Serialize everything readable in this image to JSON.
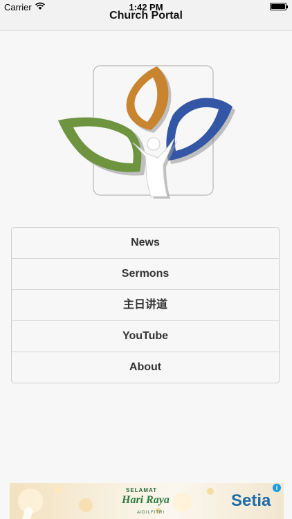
{
  "status_bar": {
    "carrier": "Carrier",
    "time": "1:42 PM"
  },
  "nav": {
    "title": "Church Portal"
  },
  "menu": {
    "items": [
      {
        "label": "News"
      },
      {
        "label": "Sermons"
      },
      {
        "label": "主日讲道"
      },
      {
        "label": "YouTube"
      },
      {
        "label": "About"
      }
    ]
  },
  "ad": {
    "selamat": "SELAMAT",
    "hari_raya": "Hari Raya",
    "aidilfitri": "AIDILFITRI",
    "brand": "Setia",
    "info_icon": "info-icon",
    "close_icon": "close-icon"
  },
  "colors": {
    "leaf_orange": "#c8842f",
    "leaf_blue": "#3457a5",
    "leaf_green": "#6e9440",
    "nav_background": "#f2f2f2"
  }
}
